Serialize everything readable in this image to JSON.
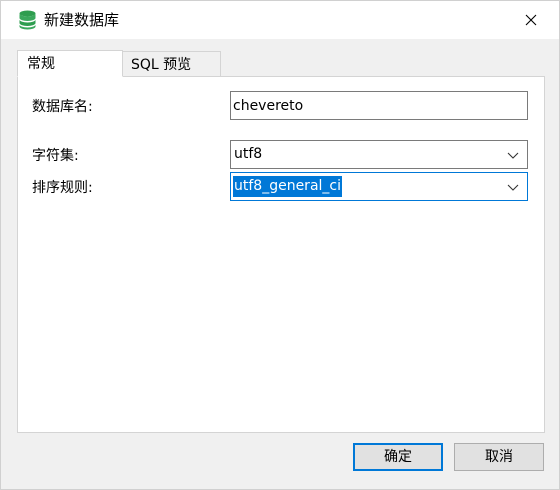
{
  "window": {
    "title": "新建数据库",
    "title_icon": "database-icon",
    "close_icon": "close-icon"
  },
  "tabs": [
    {
      "label": "常规",
      "active": true
    },
    {
      "label": "SQL 预览",
      "active": false
    }
  ],
  "form": {
    "name_label": "数据库名:",
    "name_value": "chevereto",
    "charset_label": "字符集:",
    "charset_value": "utf8",
    "collation_label": "排序规则:",
    "collation_value": "utf8_general_ci",
    "dropdown_icon": "chevron-down-icon"
  },
  "buttons": {
    "ok_label": "确定",
    "cancel_label": "取消"
  },
  "colors": {
    "accent": "#0078d7",
    "icon_green": "#2e9d4f"
  }
}
